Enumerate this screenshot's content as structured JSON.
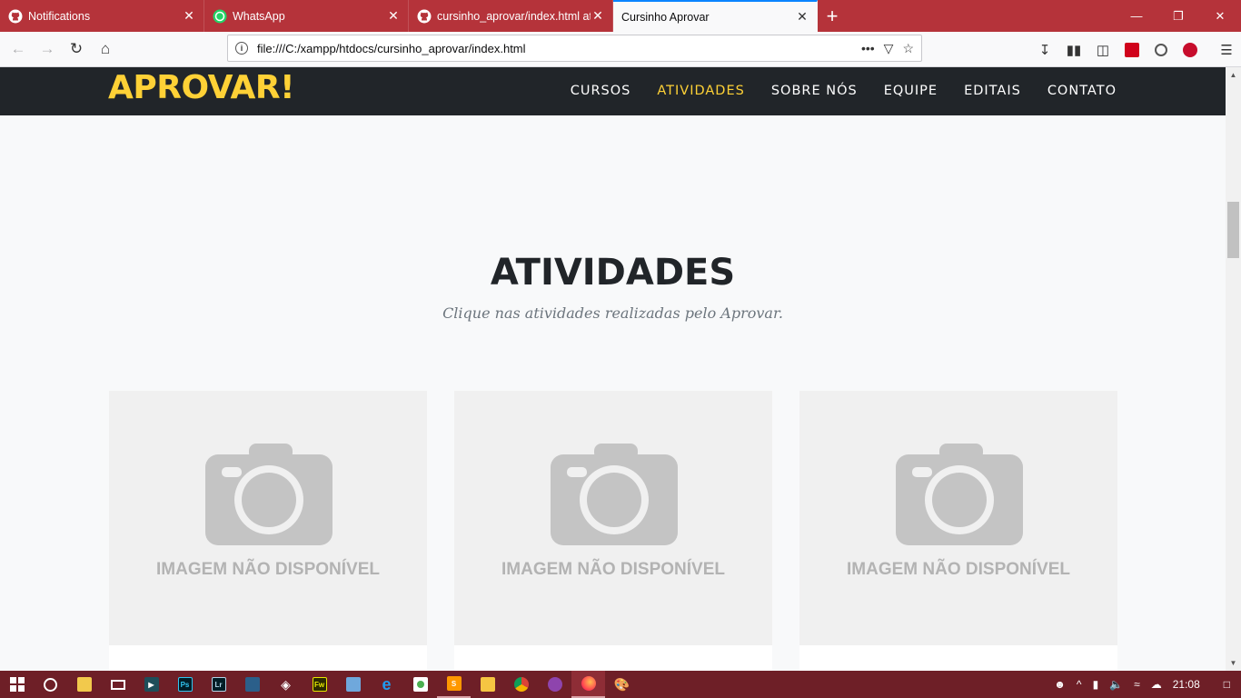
{
  "browser": {
    "tabs": [
      {
        "title": "Notifications",
        "icon": "github-icon",
        "active": false
      },
      {
        "title": "WhatsApp",
        "icon": "whatsapp-icon",
        "active": false
      },
      {
        "title": "cursinho_aprovar/index.html at",
        "icon": "github-icon",
        "active": false
      },
      {
        "title": "Cursinho Aprovar",
        "icon": "",
        "active": true
      }
    ],
    "url": "file:///C:/xampp/htdocs/cursinho_aprovar/index.html"
  },
  "site": {
    "brand": "APROVAR!",
    "menu": [
      "CURSOS",
      "ATIVIDADES",
      "SOBRE NÓS",
      "EQUIPE",
      "EDITAIS",
      "CONTATO"
    ],
    "active_menu": "ATIVIDADES",
    "section_title": "ATIVIDADES",
    "section_subtitle": "Clique nas atividades realizadas pelo Aprovar.",
    "cards": [
      {
        "placeholder_text": "IMAGEM NÃO DISPONÍVEL"
      },
      {
        "placeholder_text": "IMAGEM NÃO DISPONÍVEL"
      },
      {
        "placeholder_text": "IMAGEM NÃO DISPONÍVEL"
      }
    ]
  },
  "colors": {
    "tab_strip": "#b5333a",
    "header_bg": "#212529",
    "brand_accent": "#fed136",
    "taskbar": "#6e1f27"
  },
  "taskbar": {
    "clock": "21:08"
  }
}
